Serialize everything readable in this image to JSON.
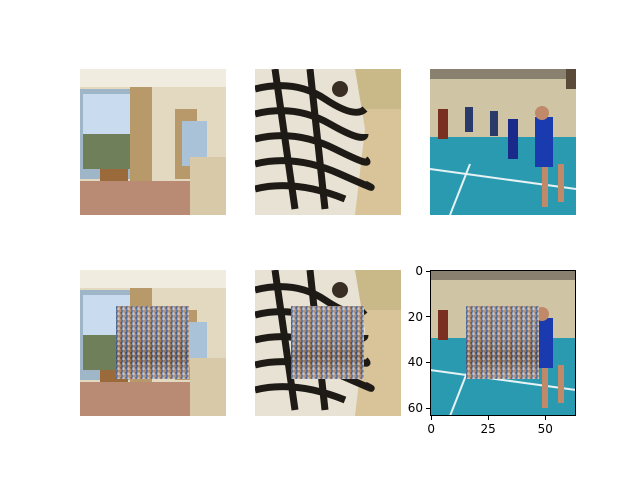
{
  "panels": {
    "top": [
      "bedroom-image",
      "zebra-image",
      "basketball-image"
    ],
    "bottom": [
      "bedroom-image-patched",
      "zebra-image-patched",
      "basketball-image-patched"
    ]
  },
  "axes": {
    "x_ticks": [
      "0",
      "25",
      "50"
    ],
    "y_ticks": [
      "0",
      "20",
      "40",
      "60"
    ],
    "x_tick_values": [
      0,
      25,
      50
    ],
    "y_tick_values": [
      0,
      20,
      40,
      60
    ],
    "xlim": [
      -0.5,
      63.5
    ],
    "ylim": [
      63.5,
      -0.5
    ]
  },
  "colors": {
    "court": "#2a9ab0",
    "wall": "#cfc4a4",
    "sand": "#d9c49a",
    "room": "#e3d8c0"
  }
}
